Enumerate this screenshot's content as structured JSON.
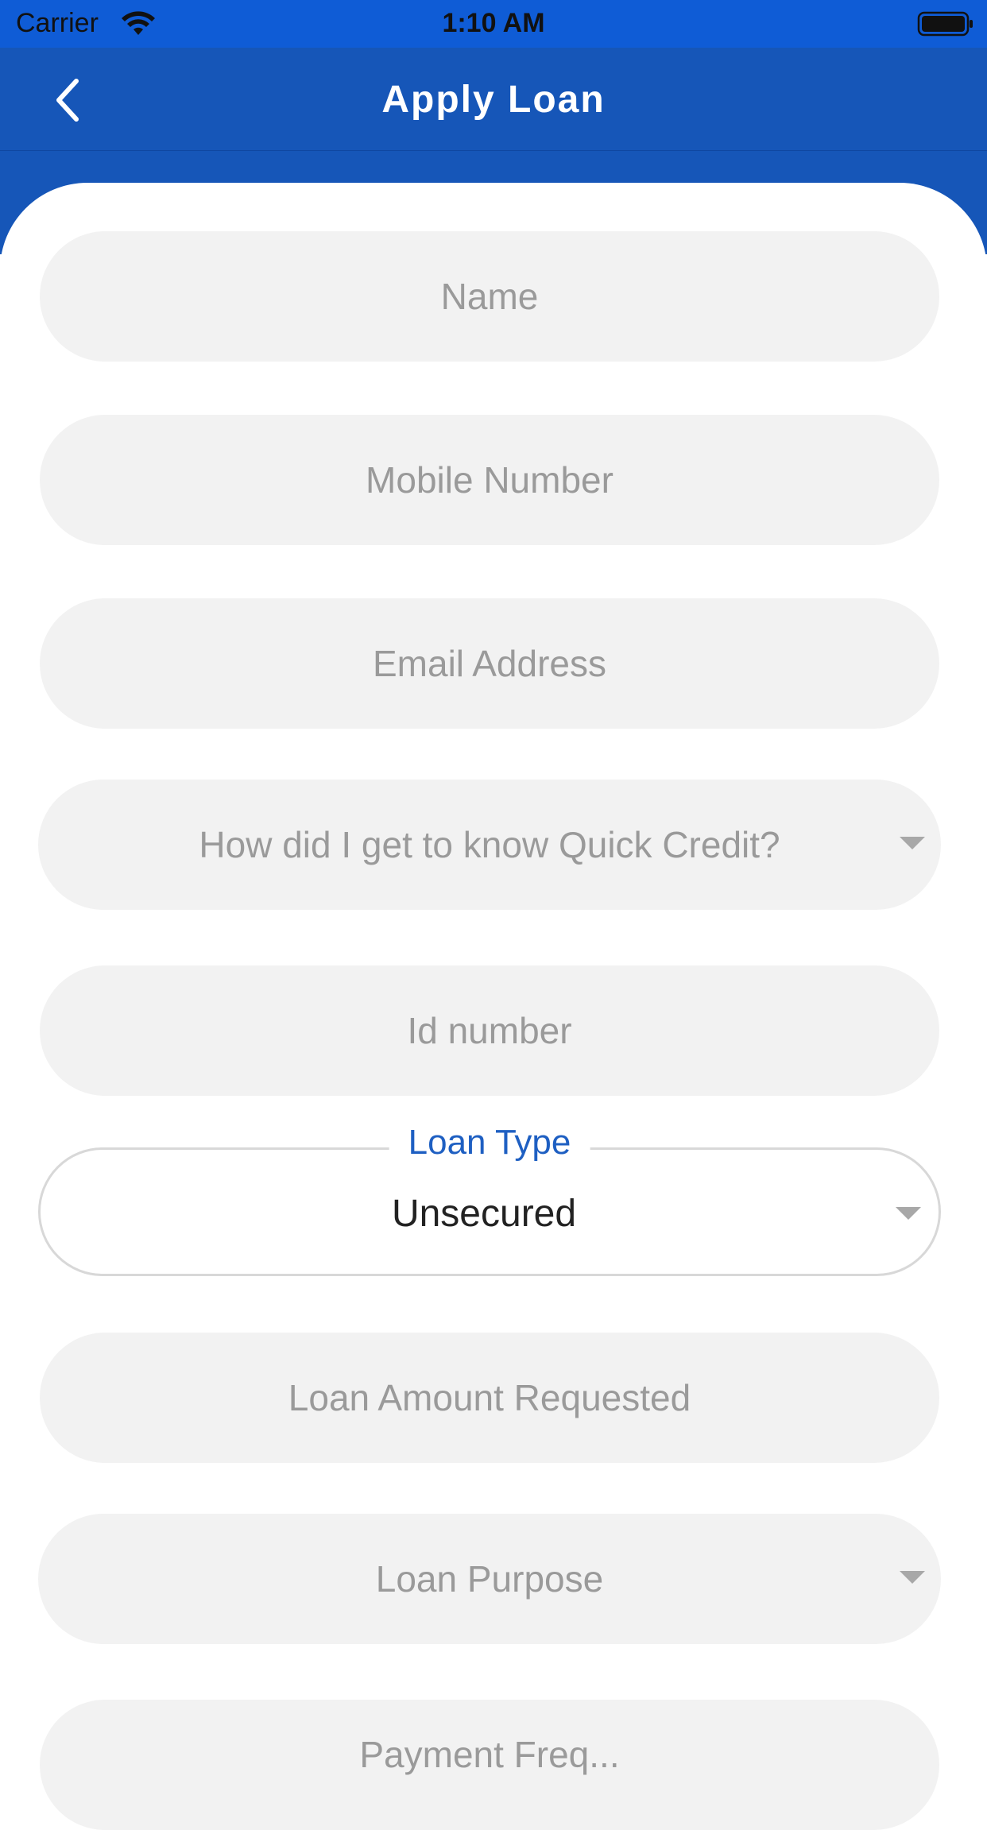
{
  "status_bar": {
    "carrier": "Carrier",
    "time": "1:10 AM",
    "wifi_icon": "wifi-icon",
    "battery_icon": "battery-full-icon"
  },
  "nav": {
    "title": "Apply Loan",
    "back_icon": "chevron-left-icon"
  },
  "colors": {
    "status_bar_bg": "#0f5cd6",
    "nav_bg": "#1656b8",
    "field_bg": "#f2f2f2",
    "placeholder": "#9a9a9a",
    "accent_label": "#1e5fc2"
  },
  "form": {
    "name_placeholder": "Name",
    "mobile_placeholder": "Mobile Number",
    "email_placeholder": "Email Address",
    "source_placeholder": "How did I get to know Quick Credit?",
    "id_placeholder": "Id number",
    "loan_type": {
      "label": "Loan Type",
      "value": "Unsecured"
    },
    "amount_placeholder": "Loan Amount Requested",
    "purpose_placeholder": "Loan Purpose",
    "partial_next_placeholder": "Payment Freq..."
  }
}
